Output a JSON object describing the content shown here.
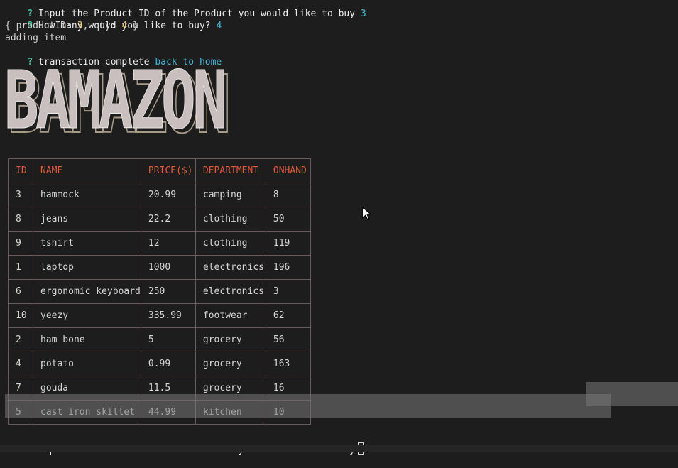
{
  "terminal": {
    "lines": [
      {
        "prompt": "?",
        "text": "Input the Product ID of the Product you would like to buy",
        "answer": "3"
      },
      {
        "prompt": "?",
        "text": "How many would you like to buy?",
        "answer": "4"
      }
    ],
    "object_line": {
      "open": "{ productID: ",
      "pid": "3",
      "mid": ", qty: ",
      "qty": "4",
      "close": " }"
    },
    "adding": "adding item",
    "complete": {
      "prompt": "?",
      "text": "transaction complete",
      "link": "back to home"
    },
    "final_prompt": {
      "prompt": "?",
      "text": "Input the Product ID of the Product you would like to buy"
    }
  },
  "banner": {
    "text": "BAMAZON"
  },
  "table": {
    "headers": [
      "ID",
      "NAME",
      "PRICE($)",
      "DEPARTMENT",
      "ONHAND"
    ],
    "rows": [
      [
        "3",
        "hammock",
        "20.99",
        "camping",
        "8"
      ],
      [
        "8",
        "jeans",
        "22.2",
        "clothing",
        "50"
      ],
      [
        "9",
        "tshirt",
        "12",
        "clothing",
        "119"
      ],
      [
        "1",
        "laptop",
        "1000",
        "electronics",
        "196"
      ],
      [
        "6",
        "ergonomic keyboard",
        "250",
        "electronics",
        "3"
      ],
      [
        "10",
        "yeezy",
        "335.99",
        "footwear",
        "62"
      ],
      [
        "2",
        "ham bone",
        "5",
        "grocery",
        "56"
      ],
      [
        "4",
        "potato",
        "0.99",
        "grocery",
        "163"
      ],
      [
        "7",
        "gouda",
        "11.5",
        "grocery",
        "16"
      ],
      [
        "5",
        "cast iron skillet",
        "44.99",
        "kitchen",
        "10"
      ]
    ]
  },
  "colors": {
    "background": "#1e1d1d",
    "prompt": "#3fc7a0",
    "answer": "#45b8d8",
    "number": "#e8c06a",
    "header": "#e05a3a",
    "border": "#6b5a5a"
  }
}
